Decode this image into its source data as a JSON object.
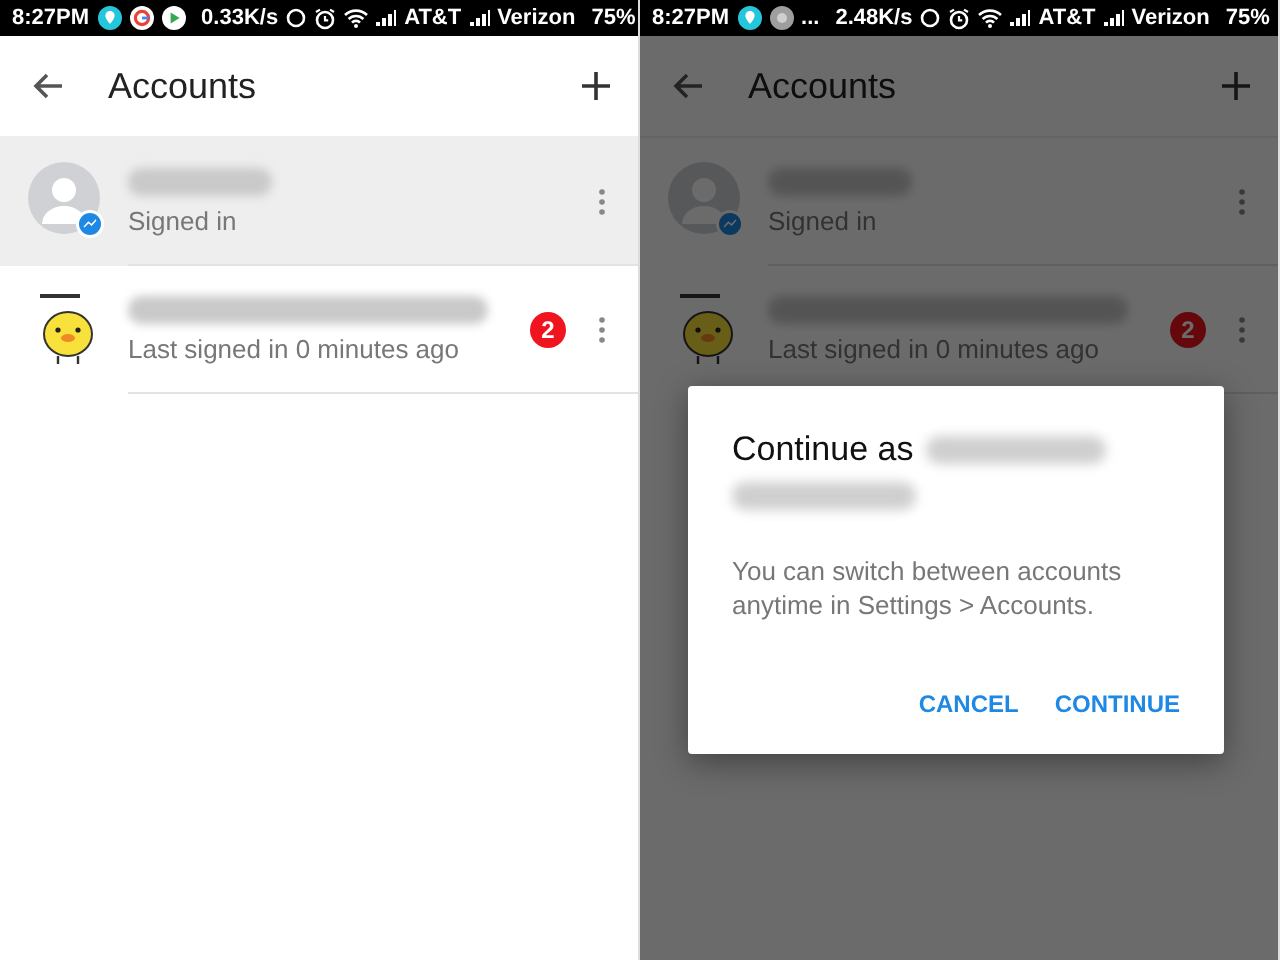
{
  "screens": [
    {
      "status_bar": {
        "time": "8:27PM",
        "notification_icons": [
          {
            "kind": "location"
          },
          {
            "kind": "google"
          },
          {
            "kind": "play"
          }
        ],
        "speed": "0.33K/s",
        "carriers": [
          "AT&T",
          "Verizon"
        ],
        "battery": "75%"
      },
      "app_bar": {
        "title": "Accounts"
      },
      "accounts": [
        {
          "kind": "silhouette",
          "status": "Signed in",
          "selected": true
        },
        {
          "kind": "sticker",
          "status": "Last signed in 0 minutes ago",
          "badge": "2",
          "selected": false
        }
      ]
    },
    {
      "status_bar": {
        "time": "8:27PM",
        "notification_icons": [
          {
            "kind": "location"
          },
          {
            "kind": "generic"
          }
        ],
        "overflow": "...",
        "speed": "2.48K/s",
        "carriers": [
          "AT&T",
          "Verizon"
        ],
        "battery": "75%"
      },
      "app_bar": {
        "title": "Accounts"
      },
      "accounts": [
        {
          "kind": "silhouette",
          "status": "Signed in"
        },
        {
          "kind": "sticker",
          "status": "Last signed in 0 minutes ago",
          "badge": "2"
        }
      ],
      "dialog": {
        "title": "Continue as",
        "message": "You can switch between accounts anytime in Settings > Accounts.",
        "buttons": [
          "CANCEL",
          "CONTINUE"
        ]
      }
    }
  ]
}
